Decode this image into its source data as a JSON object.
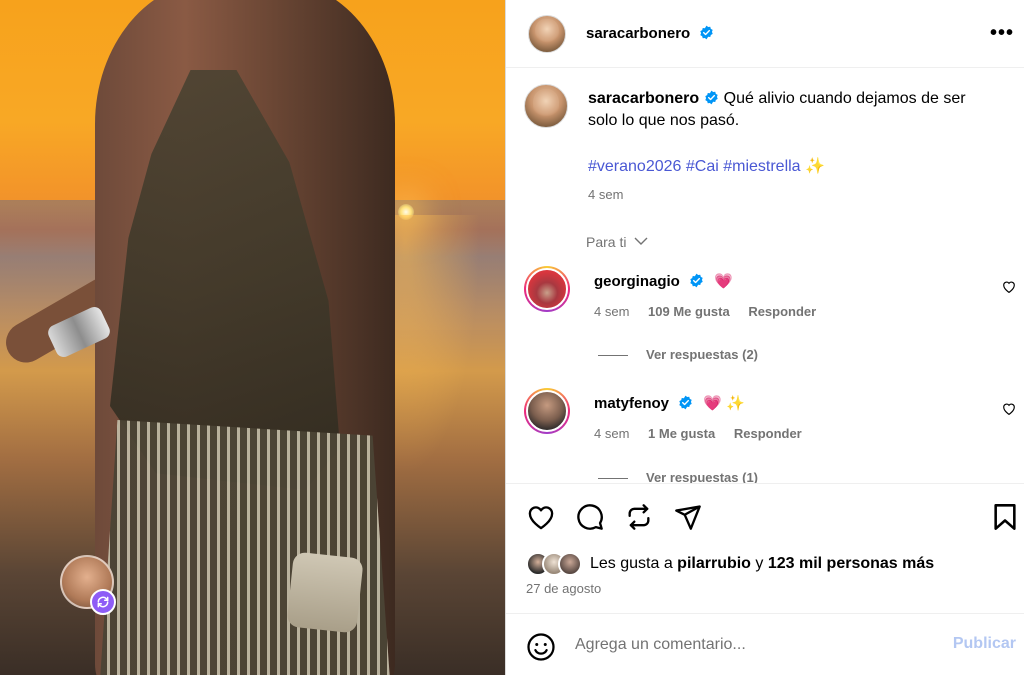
{
  "post": {
    "author": "saracarbonero",
    "caption_text": "Qué alivio cuando dejamos de ser solo lo que nos pasó.",
    "hashtags": "#verano2026 #Cai #miestrella ✨",
    "time": "4 sem",
    "more_label": "•••"
  },
  "section_label": "Para ti",
  "comments": [
    {
      "user": "georginagio",
      "emoji": "💗",
      "time": "4 sem",
      "likes": "109 Me gusta",
      "reply_label": "Responder",
      "view_replies": "Ver respuestas (2)"
    },
    {
      "user": "matyfenoy",
      "emoji": "💗 ✨",
      "time": "4 sem",
      "likes": "1 Me gusta",
      "reply_label": "Responder",
      "view_replies": "Ver respuestas (1)"
    }
  ],
  "likes_summary": {
    "prefix": "Les gusta a ",
    "user": "pilarrubio",
    "middle": " y ",
    "others": "123 mil personas más"
  },
  "date": "27 de agosto",
  "composer": {
    "placeholder": "Agrega un comentario...",
    "publish_label": "Publicar"
  },
  "icons": {
    "like": "heart-icon",
    "comment": "comment-icon",
    "repost": "repost-icon",
    "share": "send-icon",
    "save": "bookmark-icon",
    "emoji": "emoji-icon",
    "remix": "remix-icon"
  },
  "colors": {
    "verified": "#0095f6",
    "hashtag": "#4a58d4",
    "muted": "#737373",
    "publish_disabled": "#b3c7f2",
    "remix_badge": "#8e5cf6"
  }
}
